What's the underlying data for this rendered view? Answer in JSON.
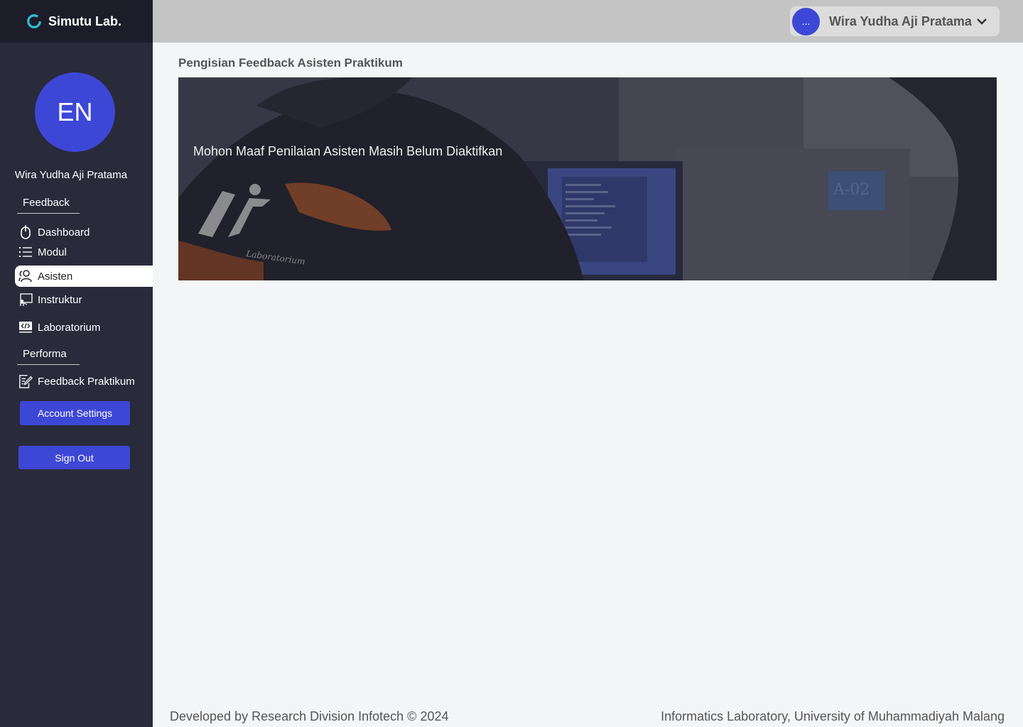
{
  "brand": {
    "name": "Simutu Lab."
  },
  "sidebar": {
    "avatar_initials": "EN",
    "user_name": "Wira Yudha Aji Pratama",
    "sections": {
      "feedback": "Feedback",
      "performa": "Performa"
    },
    "items": [
      {
        "label": "Dashboard",
        "icon": "mouse-icon"
      },
      {
        "label": "Modul",
        "icon": "list-icon"
      },
      {
        "label": "Asisten",
        "icon": "users-icon",
        "active": true
      },
      {
        "label": "Instruktur",
        "icon": "instructor-board-icon"
      },
      {
        "label": "Laboratorium",
        "icon": "code-screen-icon"
      },
      {
        "label": "Feedback Praktikum",
        "icon": "edit-document-icon"
      }
    ],
    "account_settings_label": "Account Settings",
    "sign_out_label": "Sign Out"
  },
  "header": {
    "avatar_text": "...",
    "user_name": "Wira Yudha Aji Pratama"
  },
  "main": {
    "title": "Pengisian Feedback Asisten Praktikum",
    "banner_message": "Mohon Maaf Penilaian Asisten Masih Belum Diaktifkan"
  },
  "footer": {
    "left": "Developed by Research Division Infotech © 2024",
    "right": "Informatics Laboratory, University of Muhammadiyah Malang"
  },
  "colors": {
    "accent": "#3d47d6",
    "sidebar_bg": "#292a3a",
    "brand_bg": "#1c1d28",
    "topbar_bg": "#c4c4c4",
    "page_bg": "#f4f5f7"
  }
}
